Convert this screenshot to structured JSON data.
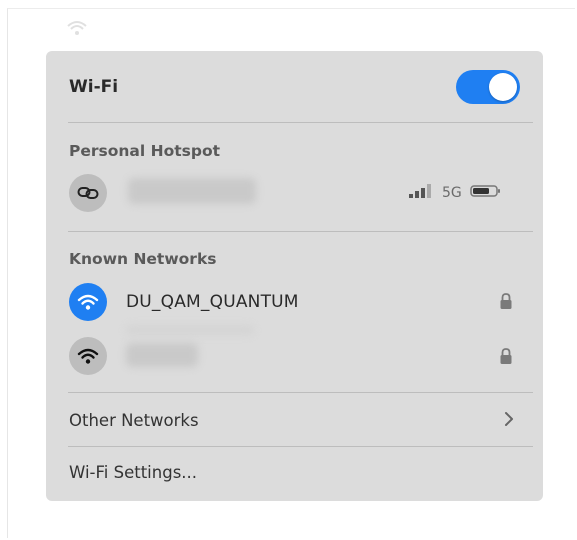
{
  "wifi": {
    "title": "Wi-Fi",
    "enabled": true,
    "accent_color": "#1f7ff2"
  },
  "hotspot": {
    "section_label": "Personal Hotspot",
    "icon": "link-icon",
    "network_type": "5G",
    "signal_icon": "signal-bars-icon",
    "battery_icon": "battery-icon"
  },
  "known_networks": {
    "section_label": "Known Networks",
    "items": [
      {
        "name": "DU_QAM_QUANTUM",
        "icon": "wifi-icon",
        "connected": true,
        "secured": true
      },
      {
        "name": "",
        "icon": "wifi-icon",
        "connected": false,
        "secured": true
      }
    ]
  },
  "other_networks": {
    "label": "Other Networks",
    "icon": "chevron-right-icon"
  },
  "settings": {
    "label": "Wi-Fi Settings..."
  }
}
